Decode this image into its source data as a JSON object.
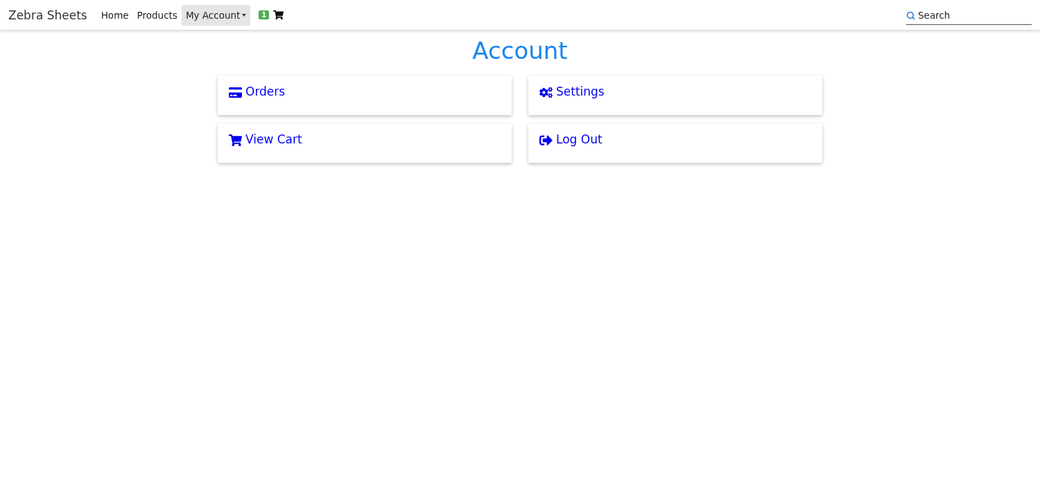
{
  "brand": "Zebra Sheets",
  "nav": [
    {
      "label": "Home",
      "selected": false,
      "kind": "link"
    },
    {
      "label": "Products",
      "selected": false,
      "kind": "link"
    },
    {
      "label": "My Account",
      "selected": true,
      "kind": "dropdown"
    }
  ],
  "cart": {
    "count": "1"
  },
  "search": {
    "placeholder": "Search"
  },
  "page_title": "Account",
  "cards": [
    {
      "label": "Orders",
      "kind": "orders"
    },
    {
      "label": "Settings",
      "kind": "settings"
    },
    {
      "label": "View Cart",
      "kind": "cart"
    },
    {
      "label": "Log Out",
      "kind": "logout"
    }
  ]
}
